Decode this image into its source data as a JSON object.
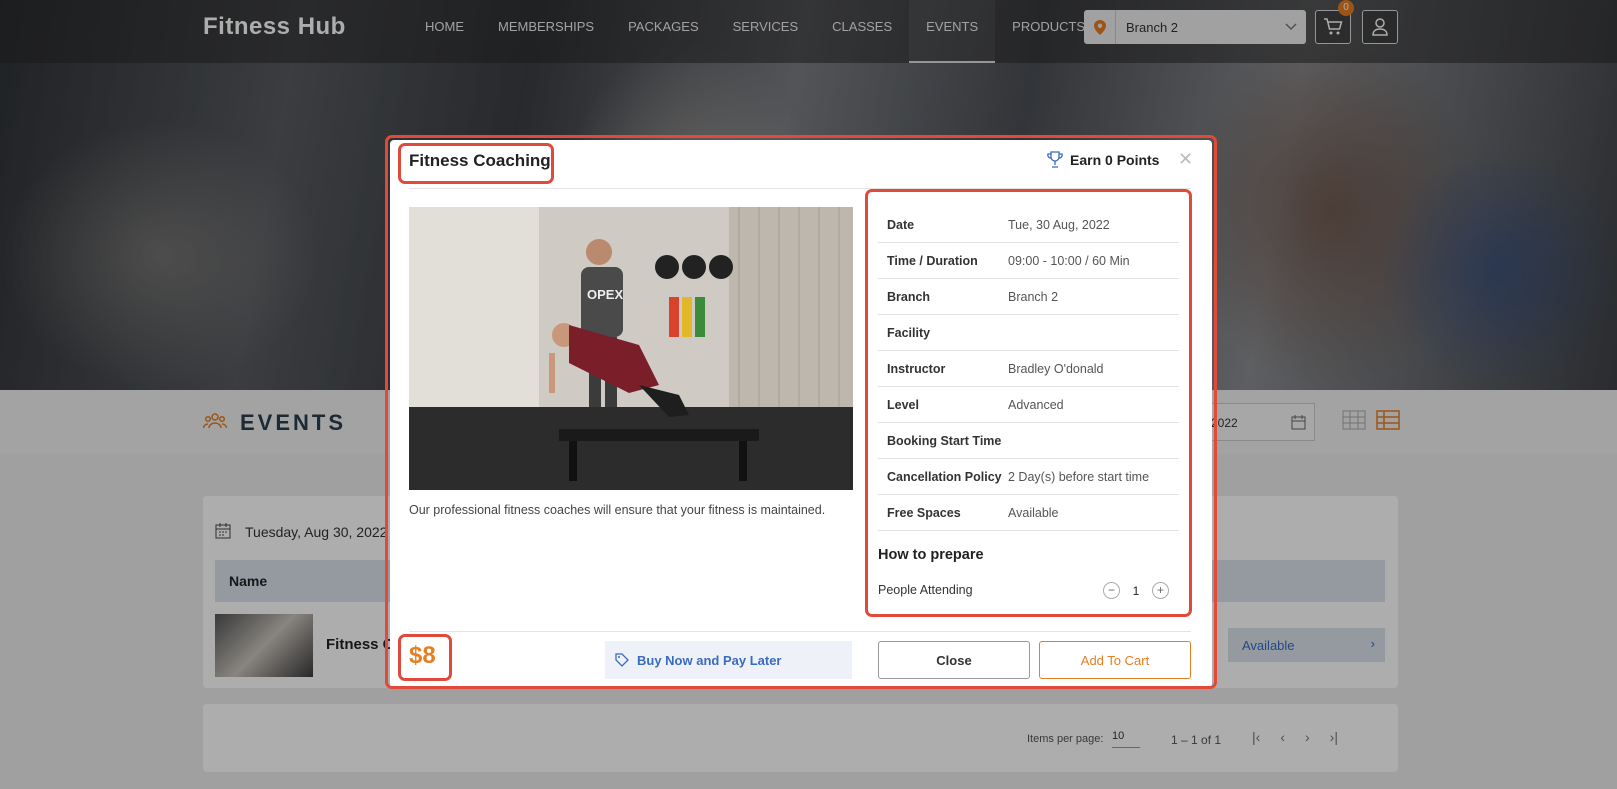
{
  "header": {
    "brand": "Fitness Hub",
    "nav": [
      "HOME",
      "MEMBERSHIPS",
      "PACKAGES",
      "SERVICES",
      "CLASSES",
      "EVENTS",
      "PRODUCTS"
    ],
    "active_nav": "EVENTS",
    "branch": "Branch 2",
    "cart_count": "0"
  },
  "events_page": {
    "title": "EVENTS",
    "date_filter": "2022",
    "list_date": "Tuesday, Aug 30, 2022",
    "column_name": "Name",
    "row_name": "Fitness C",
    "row_status": "Available",
    "pager": {
      "items_per_page_label": "Items per page:",
      "page_size": "10",
      "range": "1 – 1 of 1"
    }
  },
  "modal": {
    "title": "Fitness Coaching",
    "earn_points": "Earn 0 Points",
    "description": "Our professional fitness coaches will ensure that your fitness is maintained.",
    "details": [
      {
        "label": "Date",
        "value": "Tue, 30 Aug, 2022"
      },
      {
        "label": "Time / Duration",
        "value": "09:00 - 10:00 / 60 Min"
      },
      {
        "label": "Branch",
        "value": "Branch 2"
      },
      {
        "label": "Facility",
        "value": ""
      },
      {
        "label": "Instructor",
        "value": "Bradley O'donald"
      },
      {
        "label": "Level",
        "value": "Advanced"
      },
      {
        "label": "Booking Start Time",
        "value": ""
      },
      {
        "label": "Cancellation Policy",
        "value": "2 Day(s) before start time"
      },
      {
        "label": "Free Spaces",
        "value": "Available"
      }
    ],
    "how_to_prepare": "How to prepare",
    "people_attending_label": "People Attending",
    "people_attending_value": "1",
    "price": "$8",
    "bnpl_label": "Buy Now and Pay Later",
    "close_label": "Close",
    "add_to_cart_label": "Add To Cart",
    "photo_shirt_text": "OPEX"
  },
  "colors": {
    "accent": "#e67e22",
    "highlight": "#e04a3a",
    "link": "#3a6bbf"
  }
}
